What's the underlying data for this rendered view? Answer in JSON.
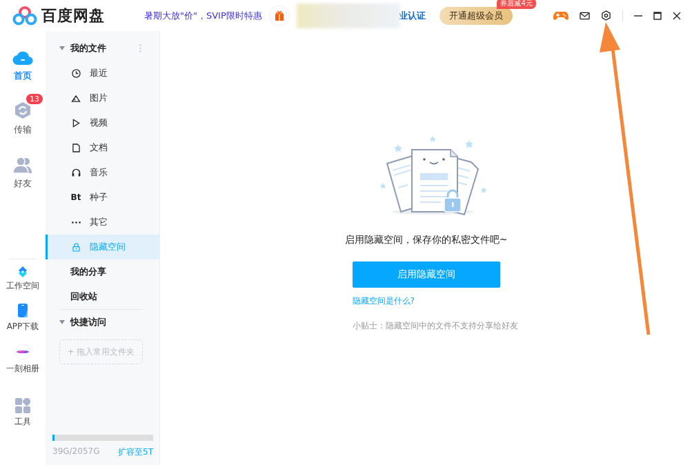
{
  "app": {
    "title": "百度网盘"
  },
  "topbar": {
    "promo": "暑期大放\"价\"，SVIP限时特惠",
    "enterprise": "业认证",
    "vip_button": "开通超级会员",
    "vip_badge": "券后减4元"
  },
  "rail": {
    "top": [
      {
        "label": "首页",
        "kind": "home",
        "selected": true
      },
      {
        "label": "传输",
        "kind": "transfer",
        "selected": false,
        "badge": "13"
      },
      {
        "label": "好友",
        "kind": "friends",
        "selected": false
      }
    ],
    "bottom": [
      {
        "label": "工作空间",
        "kind": "workspace"
      },
      {
        "label": "APP下载",
        "kind": "phone"
      },
      {
        "label": "一刻相册",
        "kind": "album"
      },
      {
        "label": "工具",
        "kind": "tools"
      }
    ]
  },
  "sidebar": {
    "my_files": {
      "label": "我的文件",
      "expanded": true,
      "items": [
        {
          "label": "最近",
          "kind": "recent",
          "selected": false
        },
        {
          "label": "图片",
          "kind": "image",
          "selected": false
        },
        {
          "label": "视频",
          "kind": "video",
          "selected": false
        },
        {
          "label": "文档",
          "kind": "doc",
          "selected": false
        },
        {
          "label": "音乐",
          "kind": "music",
          "selected": false
        },
        {
          "label": "种子",
          "kind": "text",
          "icon_text": "Bt",
          "selected": false
        },
        {
          "label": "其它",
          "kind": "more",
          "selected": false
        },
        {
          "label": "隐藏空间",
          "kind": "lock",
          "selected": true
        }
      ]
    },
    "links": [
      {
        "label": "我的分享",
        "selected": false
      },
      {
        "label": "回收站",
        "selected": false
      }
    ],
    "quick_access": {
      "label": "快捷访问",
      "expanded": true,
      "drop_hint": "+ 拖入常用文件夹"
    },
    "storage": {
      "used": "39G/2057G",
      "level": 0.02,
      "upgrade": "扩容至5T"
    }
  },
  "main": {
    "message": "启用隐藏空间，保存你的私密文件吧~",
    "button": "启用隐藏空间",
    "link": "隐藏空间是什么?",
    "tip": "小贴士：隐藏空间中的文件不支持分享给好友"
  }
}
